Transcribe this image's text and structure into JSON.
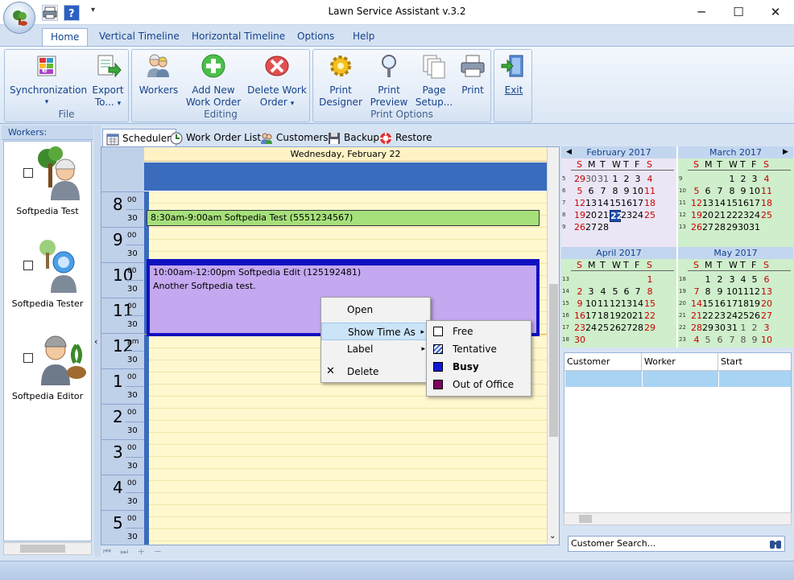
{
  "window": {
    "title": "Lawn Service Assistant v.3.2",
    "controls": {
      "minimize": "─",
      "maximize": "☐",
      "close": "✕"
    },
    "qat_menu_glyph": "▾"
  },
  "ribbon_tabs": [
    "Home",
    "Vertical Timeline",
    "Horizontal Timeline",
    "Options",
    "Help"
  ],
  "ribbon": {
    "file": {
      "label": "File",
      "sync": "Synchronization",
      "export": "Export",
      "export2": "To..."
    },
    "editing": {
      "label": "Editing",
      "workers": "Workers",
      "add1": "Add New",
      "add2": "Work Order",
      "del1": "Delete Work",
      "del2": "Order"
    },
    "print": {
      "label": "Print Options",
      "designer1": "Print",
      "designer2": "Designer",
      "preview1": "Print",
      "preview2": "Preview",
      "setup1": "Page",
      "setup2": "Setup...",
      "print": "Print"
    },
    "exit": {
      "label": "Exit"
    },
    "dropdown_glyph": "▾"
  },
  "workers": {
    "header": "Workers:",
    "items": [
      {
        "name": "Softpedia Test"
      },
      {
        "name": "Softpedia Tester"
      },
      {
        "name": "Softpedia Editor"
      }
    ]
  },
  "scheduler_tabs": [
    "Scheduler",
    "Work Order List",
    "Customers",
    "Backup",
    "Restore"
  ],
  "scheduler": {
    "date_header": "Wednesday, February 22",
    "hours": [
      {
        "h": "8",
        "m": "00"
      },
      {
        "h": "9",
        "m": "00"
      },
      {
        "h": "10",
        "m": "00"
      },
      {
        "h": "11",
        "m": "00"
      },
      {
        "h": "12",
        "m": "pm"
      },
      {
        "h": "1",
        "m": "00"
      },
      {
        "h": "2",
        "m": "00"
      },
      {
        "h": "3",
        "m": "00"
      },
      {
        "h": "4",
        "m": "00"
      },
      {
        "h": "5",
        "m": "00"
      }
    ],
    "half_label": "30",
    "appointments": [
      {
        "title": "8:30am-9:00am Softpedia Test (5551234567)",
        "notes": ""
      },
      {
        "title": "10:00am-12:00pm Softpedia Edit (125192481)",
        "notes": "Another Softpedia test."
      }
    ],
    "footer_glyphs": "⏮ ⏭ + −",
    "collapse_glyph": "‹",
    "scroll_down_glyph": "⌄"
  },
  "context_menu": {
    "items": [
      "Open",
      "Show Time As",
      "Label",
      "Delete"
    ],
    "arrow_glyph": "▸",
    "delete_glyph": "✕",
    "submenu": [
      {
        "label": "Free",
        "color": "#ffffff"
      },
      {
        "label": "Tentative",
        "color": "#3a5fd0"
      },
      {
        "label": "Busy",
        "color": "#1018d8"
      },
      {
        "label": "Out of Office",
        "color": "#800060"
      }
    ]
  },
  "calendars": {
    "dow": [
      "S",
      "M",
      "T",
      "W",
      "T",
      "F",
      "S"
    ],
    "nav_prev_glyph": "◀",
    "nav_next_glyph": "▶",
    "months": [
      {
        "title": "February 2017",
        "bg": "#ebe6f5",
        "weeks": [
          "5",
          "6",
          "7",
          "8",
          "9"
        ],
        "days": [
          [
            "29",
            "30",
            "31",
            "1",
            "2",
            "3",
            "4"
          ],
          [
            "5",
            "6",
            "7",
            "8",
            "9",
            "10",
            "11"
          ],
          [
            "12",
            "13",
            "14",
            "15",
            "16",
            "17",
            "18"
          ],
          [
            "19",
            "20",
            "21",
            "22",
            "23",
            "24",
            "25"
          ],
          [
            "26",
            "27",
            "28",
            "",
            "",
            "",
            ""
          ]
        ]
      },
      {
        "title": "March 2017",
        "bg": "#cfeecb",
        "weeks": [
          "9",
          "10",
          "11",
          "12",
          "13"
        ],
        "days": [
          [
            "",
            "",
            "",
            "1",
            "2",
            "3",
            "4"
          ],
          [
            "5",
            "6",
            "7",
            "8",
            "9",
            "10",
            "11"
          ],
          [
            "12",
            "13",
            "14",
            "15",
            "16",
            "17",
            "18"
          ],
          [
            "19",
            "20",
            "21",
            "22",
            "23",
            "24",
            "25"
          ],
          [
            "26",
            "27",
            "28",
            "29",
            "30",
            "31",
            ""
          ]
        ]
      },
      {
        "title": "April 2017",
        "bg": "#cfeecb",
        "weeks": [
          "13",
          "14",
          "15",
          "16",
          "17",
          "18"
        ],
        "days": [
          [
            "",
            "",
            "",
            "",
            "",
            "",
            "1"
          ],
          [
            "2",
            "3",
            "4",
            "5",
            "6",
            "7",
            "8"
          ],
          [
            "9",
            "10",
            "11",
            "12",
            "13",
            "14",
            "15"
          ],
          [
            "16",
            "17",
            "18",
            "19",
            "20",
            "21",
            "22"
          ],
          [
            "23",
            "24",
            "25",
            "26",
            "27",
            "28",
            "29"
          ],
          [
            "30",
            "",
            "",
            "",
            "",
            "",
            ""
          ]
        ]
      },
      {
        "title": "May 2017",
        "bg": "#cfeecb",
        "weeks": [
          "18",
          "19",
          "20",
          "21",
          "22",
          "23"
        ],
        "days": [
          [
            "",
            "1",
            "2",
            "3",
            "4",
            "5",
            "6"
          ],
          [
            "7",
            "8",
            "9",
            "10",
            "11",
            "12",
            "13"
          ],
          [
            "14",
            "15",
            "16",
            "17",
            "18",
            "19",
            "20"
          ],
          [
            "21",
            "22",
            "23",
            "24",
            "25",
            "26",
            "27"
          ],
          [
            "28",
            "29",
            "30",
            "31",
            "1",
            "2",
            "3"
          ],
          [
            "4",
            "5",
            "6",
            "7",
            "8",
            "9",
            "10"
          ]
        ]
      }
    ],
    "selected": "22"
  },
  "customer_grid": {
    "columns": [
      "Customer",
      "Worker",
      "Start"
    ]
  },
  "search": {
    "placeholder": "Customer Search..."
  }
}
